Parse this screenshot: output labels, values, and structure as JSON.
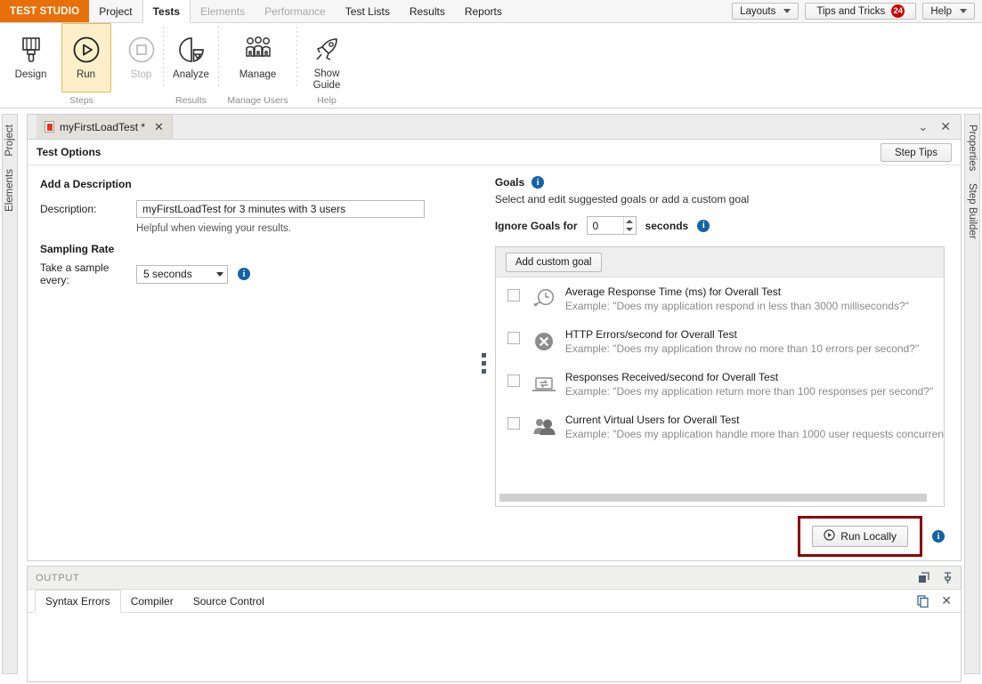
{
  "menubar": {
    "brand": "TEST STUDIO",
    "items": [
      {
        "label": "Project",
        "state": "normal"
      },
      {
        "label": "Tests",
        "state": "active"
      },
      {
        "label": "Elements",
        "state": "dim"
      },
      {
        "label": "Performance",
        "state": "dim"
      },
      {
        "label": "Test Lists",
        "state": "normal"
      },
      {
        "label": "Results",
        "state": "normal"
      },
      {
        "label": "Reports",
        "state": "normal"
      }
    ],
    "layouts_label": "Layouts",
    "tips_label": "Tips and Tricks",
    "tips_badge": "24",
    "help_label": "Help"
  },
  "ribbon": {
    "groups": [
      {
        "group_label": "Steps",
        "buttons": [
          {
            "label": "Design",
            "icon": "paint-brush-icon",
            "state": "normal"
          },
          {
            "label": "Run",
            "icon": "play-circle-icon",
            "state": "selected"
          },
          {
            "label": "Stop",
            "icon": "stop-circle-icon",
            "state": "disabled"
          }
        ]
      },
      {
        "group_label": "Results",
        "buttons": [
          {
            "label": "Analyze",
            "icon": "pie-chart-icon",
            "state": "normal"
          }
        ]
      },
      {
        "group_label": "Manage Users",
        "buttons": [
          {
            "label": "Manage",
            "icon": "users-icon",
            "state": "normal"
          }
        ]
      },
      {
        "group_label": "Help",
        "buttons": [
          {
            "label": "Show Guide",
            "icon": "rocket-icon",
            "state": "normal"
          }
        ]
      }
    ]
  },
  "dock_left": {
    "tabs": [
      "Project",
      "Elements"
    ]
  },
  "dock_right": {
    "tabs": [
      "Properties",
      "Step Builder"
    ]
  },
  "document": {
    "tab_label": "myFirstLoadTest *",
    "options_title": "Test Options",
    "step_tips_label": "Step Tips"
  },
  "description_section": {
    "title": "Add a Description",
    "field_label": "Description:",
    "value": "myFirstLoadTest for 3 minutes with 3 users",
    "hint": "Helpful when viewing your results."
  },
  "sampling_section": {
    "title": "Sampling Rate",
    "field_label": "Take a sample every:",
    "value": "5 seconds"
  },
  "goals_section": {
    "title": "Goals",
    "subtitle": "Select and edit suggested goals or add a custom goal",
    "ignore_label": "Ignore Goals for",
    "ignore_value": "0",
    "ignore_units": "seconds",
    "add_custom_goal_label": "Add custom goal",
    "goals": [
      {
        "icon": "clock-response-time-icon",
        "title": "Average Response Time (ms) for Overall Test",
        "example": "Example: \"Does my application respond in less than 3000 milliseconds?\"",
        "checked": false
      },
      {
        "icon": "error-circle-icon",
        "title": "HTTP Errors/second for Overall Test",
        "example": "Example: \"Does my application throw no more than 10 errors per second?\"",
        "checked": false
      },
      {
        "icon": "laptop-exchange-icon",
        "title": "Responses Received/second for Overall Test",
        "example": "Example: \"Does my application return more than 100 responses per second?\"",
        "checked": false
      },
      {
        "icon": "virtual-users-icon",
        "title": "Current Virtual Users for Overall Test",
        "example": "Example: \"Does my application handle more than 1000 user requests concurren",
        "checked": false
      }
    ]
  },
  "run_action": {
    "label": "Run Locally",
    "icon": "play-circle-icon",
    "highlight_color": "#8c0000"
  },
  "output_panel": {
    "title": "OUTPUT",
    "tabs": [
      {
        "label": "Syntax Errors",
        "active": true
      },
      {
        "label": "Compiler",
        "active": false
      },
      {
        "label": "Source Control",
        "active": false
      }
    ]
  }
}
